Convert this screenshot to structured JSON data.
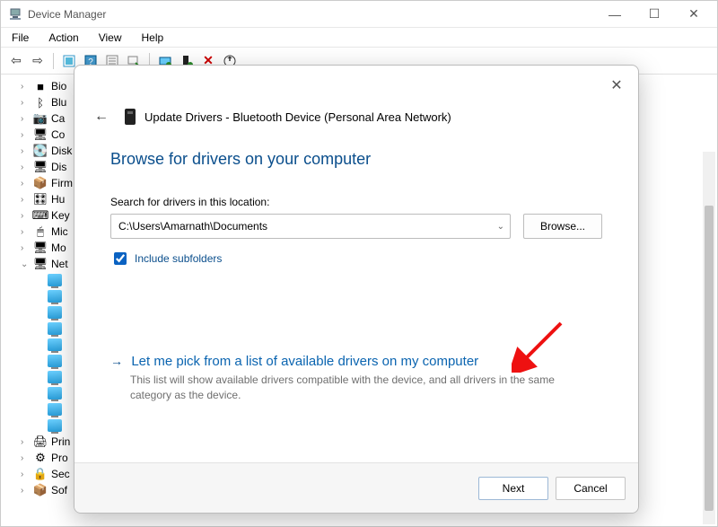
{
  "window": {
    "title": "Device Manager",
    "menu": {
      "file": "File",
      "action": "Action",
      "view": "View",
      "help": "Help"
    }
  },
  "tree": {
    "items": [
      {
        "chev": "›",
        "icon": "■",
        "label": "Bio"
      },
      {
        "chev": "›",
        "icon": "ᛒ",
        "label": "Blu"
      },
      {
        "chev": "›",
        "icon": "📷",
        "label": "Ca"
      },
      {
        "chev": "›",
        "icon": "🖥",
        "label": "Co"
      },
      {
        "chev": "›",
        "icon": "💽",
        "label": "Disk"
      },
      {
        "chev": "›",
        "icon": "🖥",
        "label": "Dis"
      },
      {
        "chev": "›",
        "icon": "📦",
        "label": "Firm"
      },
      {
        "chev": "›",
        "icon": "🎛",
        "label": "Hu"
      },
      {
        "chev": "›",
        "icon": "⌨",
        "label": "Key"
      },
      {
        "chev": "›",
        "icon": "🖱",
        "label": "Mic"
      },
      {
        "chev": "›",
        "icon": "🖥",
        "label": "Mo"
      },
      {
        "chev": "⌄",
        "icon": "🖥",
        "label": "Net"
      }
    ],
    "bottom": [
      {
        "chev": "›",
        "icon": "🖨",
        "label": "Prin"
      },
      {
        "chev": "›",
        "icon": "⚙",
        "label": "Pro"
      },
      {
        "chev": "›",
        "icon": "🔒",
        "label": "Sec"
      },
      {
        "chev": "›",
        "icon": "📦",
        "label": "Sof"
      }
    ]
  },
  "dialog": {
    "header_title": "Update Drivers - Bluetooth Device (Personal Area Network)",
    "heading": "Browse for drivers on your computer",
    "search_label": "Search for drivers in this location:",
    "path_value": "C:\\Users\\Amarnath\\Documents",
    "browse": "Browse...",
    "include_subfolders": "Include subfolders",
    "option_title": "Let me pick from a list of available drivers on my computer",
    "option_desc": "This list will show available drivers compatible with the device, and all drivers in the same category as the device.",
    "next": "Next",
    "cancel": "Cancel"
  }
}
